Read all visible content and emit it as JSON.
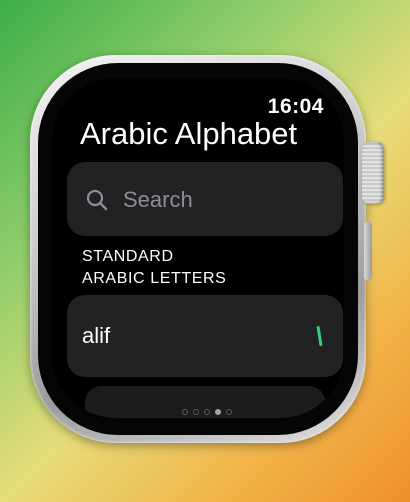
{
  "status_bar": {
    "time": "16:04"
  },
  "app": {
    "title": "Arabic Alphabet"
  },
  "search": {
    "placeholder": "Search",
    "icon": "search-icon"
  },
  "section": {
    "header_line1": "STANDARD",
    "header_line2": "ARABIC LETTERS"
  },
  "letters": [
    {
      "name": "alif",
      "glyph": "ا",
      "glyph_color": "#35d07f"
    }
  ],
  "colors": {
    "screen_background": "#000000",
    "card_background": "#222224",
    "placeholder_text": "#8e8e93",
    "accent_green": "#35d07f"
  },
  "page_indicator": {
    "count": 5,
    "active": 3
  }
}
